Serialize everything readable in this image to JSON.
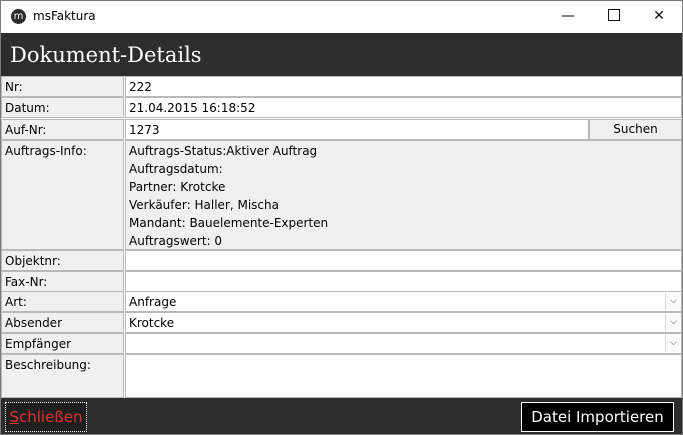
{
  "window": {
    "app_icon_glyph": "m",
    "title": "msFaktura",
    "min_glyph": "—",
    "close_glyph": "✕"
  },
  "header": {
    "title": "Dokument-Details"
  },
  "form": {
    "nr": {
      "label": "Nr:",
      "value": "222"
    },
    "datum": {
      "label": "Datum:",
      "value": "21.04.2015 16:18:52"
    },
    "auf_nr": {
      "label": "Auf-Nr:",
      "value": "1273",
      "search_label": "Suchen"
    },
    "auftrags_info": {
      "label": "Auftrags-Info:",
      "lines": [
        "Auftrags-Status:Aktiver Auftrag",
        "Auftragsdatum:",
        "Partner: Krotcke",
        "Verkäufer: Haller, Mischa",
        "Mandant: Bauelemente-Experten",
        "Auftragswert: 0"
      ]
    },
    "objektnr": {
      "label": "Objektnr:",
      "value": ""
    },
    "fax_nr": {
      "label": "Fax-Nr:",
      "value": ""
    },
    "art": {
      "label": "Art:",
      "value": "Anfrage"
    },
    "absender": {
      "label": "Absender",
      "value": "Krotcke"
    },
    "empfaenger": {
      "label": "Empfänger",
      "value": ""
    },
    "beschreibung": {
      "label": "Beschreibung:",
      "value": ""
    },
    "dropdown_glyph": "⌵"
  },
  "footer": {
    "close_first_letter": "S",
    "close_rest": "chließen",
    "import_label": "Datei Importieren"
  }
}
